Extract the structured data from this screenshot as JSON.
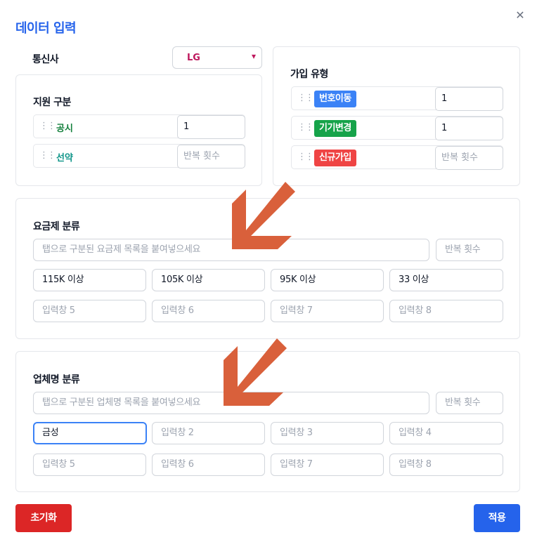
{
  "dialog": {
    "title": "데이터 입력",
    "close_icon": "✕"
  },
  "carrier": {
    "label": "통신사",
    "value": "LG",
    "chevron": "⌄"
  },
  "support": {
    "label": "지원 구분",
    "items": [
      {
        "name": "공시",
        "color": "#15803d",
        "repeat": "1",
        "repeat_placeholder": ""
      },
      {
        "name": "선약",
        "color": "#0d9488",
        "repeat": "",
        "repeat_placeholder": "반복 횟수"
      }
    ]
  },
  "join": {
    "label": "가입 유형",
    "items": [
      {
        "name": "번호이동",
        "color": "#3b82f6",
        "repeat": "1",
        "repeat_placeholder": ""
      },
      {
        "name": "기기변경",
        "color": "#16a34a",
        "repeat": "1",
        "repeat_placeholder": ""
      },
      {
        "name": "신규가입",
        "color": "#ef4444",
        "repeat": "",
        "repeat_placeholder": "반복 횟수"
      }
    ]
  },
  "plan": {
    "label": "요금제 분류",
    "paste_placeholder": "탭으로 구분된 요금제 목록을 붙여넣으세요",
    "repeat_placeholder": "반복 횟수",
    "fields": [
      {
        "value": "115K 이상",
        "placeholder": ""
      },
      {
        "value": "105K 이상",
        "placeholder": ""
      },
      {
        "value": "95K 이상",
        "placeholder": ""
      },
      {
        "value": "33 이상",
        "placeholder": ""
      },
      {
        "value": "",
        "placeholder": "입력창 5"
      },
      {
        "value": "",
        "placeholder": "입력창 6"
      },
      {
        "value": "",
        "placeholder": "입력창 7"
      },
      {
        "value": "",
        "placeholder": "입력창 8"
      }
    ]
  },
  "vendor": {
    "label": "업체명 분류",
    "paste_placeholder": "탭으로 구분된 업체명 목록을 붙여넣으세요",
    "repeat_placeholder": "반복 횟수",
    "fields": [
      {
        "value": "금성",
        "placeholder": ""
      },
      {
        "value": "",
        "placeholder": "입력창 2"
      },
      {
        "value": "",
        "placeholder": "입력창 3"
      },
      {
        "value": "",
        "placeholder": "입력창 4"
      },
      {
        "value": "",
        "placeholder": "입력창 5"
      },
      {
        "value": "",
        "placeholder": "입력창 6"
      },
      {
        "value": "",
        "placeholder": "입력창 7"
      },
      {
        "value": "",
        "placeholder": "입력창 8"
      }
    ]
  },
  "buttons": {
    "reset": "초기화",
    "apply": "적용"
  },
  "colors": {
    "accent": "#2563eb",
    "danger": "#dc2626",
    "arrow": "#d9603b",
    "carrier": "#be185d"
  },
  "icons": {
    "drag_handle": "drag-handle-icon",
    "annotation": "arrow-down-left-icon"
  }
}
